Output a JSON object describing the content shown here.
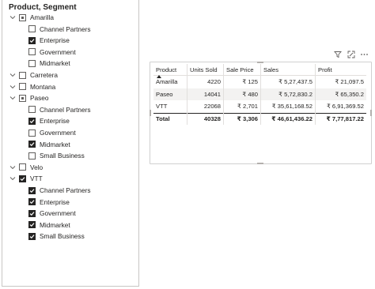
{
  "slicer": {
    "title": "Product, Segment",
    "products": [
      {
        "label": "Amarilla",
        "state": "partial",
        "expanded": true,
        "segments": [
          {
            "label": "Channel Partners",
            "checked": false
          },
          {
            "label": "Enterprise",
            "checked": true
          },
          {
            "label": "Government",
            "checked": false
          },
          {
            "label": "Midmarket",
            "checked": false
          }
        ]
      },
      {
        "label": "Carretera",
        "state": "unchecked",
        "expanded": false,
        "segments": []
      },
      {
        "label": "Montana",
        "state": "unchecked",
        "expanded": false,
        "segments": []
      },
      {
        "label": "Paseo",
        "state": "partial",
        "expanded": true,
        "segments": [
          {
            "label": "Channel Partners",
            "checked": false
          },
          {
            "label": "Enterprise",
            "checked": true
          },
          {
            "label": "Government",
            "checked": false
          },
          {
            "label": "Midmarket",
            "checked": true
          },
          {
            "label": "Small Business",
            "checked": false
          }
        ]
      },
      {
        "label": "Velo",
        "state": "unchecked",
        "expanded": false,
        "segments": []
      },
      {
        "label": "VTT",
        "state": "checked",
        "expanded": true,
        "segments": [
          {
            "label": "Channel Partners",
            "checked": true
          },
          {
            "label": "Enterprise",
            "checked": true
          },
          {
            "label": "Government",
            "checked": true
          },
          {
            "label": "Midmarket",
            "checked": true
          },
          {
            "label": "Small Business",
            "checked": true
          }
        ]
      }
    ]
  },
  "visual": {
    "icons": [
      "filter-icon",
      "focus-mode-icon",
      "more-options-icon"
    ],
    "columns": [
      "Product",
      "Units Sold",
      "Sale Price",
      "Sales",
      "Profit"
    ],
    "rows": [
      [
        "Amarilla",
        "4220",
        "₹ 125",
        "₹ 5,27,437.5",
        "₹ 21,097.5"
      ],
      [
        "Paseo",
        "14041",
        "₹ 480",
        "₹ 5,72,830.2",
        "₹ 65,350.2"
      ],
      [
        "VTT",
        "22068",
        "₹ 2,701",
        "₹ 35,61,168.52",
        "₹ 6,91,369.52"
      ]
    ],
    "total": [
      "Total",
      "40328",
      "₹ 3,306",
      "₹ 46,61,436.22",
      "₹ 7,77,817.22"
    ]
  },
  "colors": {
    "border": "#c8c6c4",
    "text": "#252423",
    "alt_row": "#f3f2f1"
  }
}
